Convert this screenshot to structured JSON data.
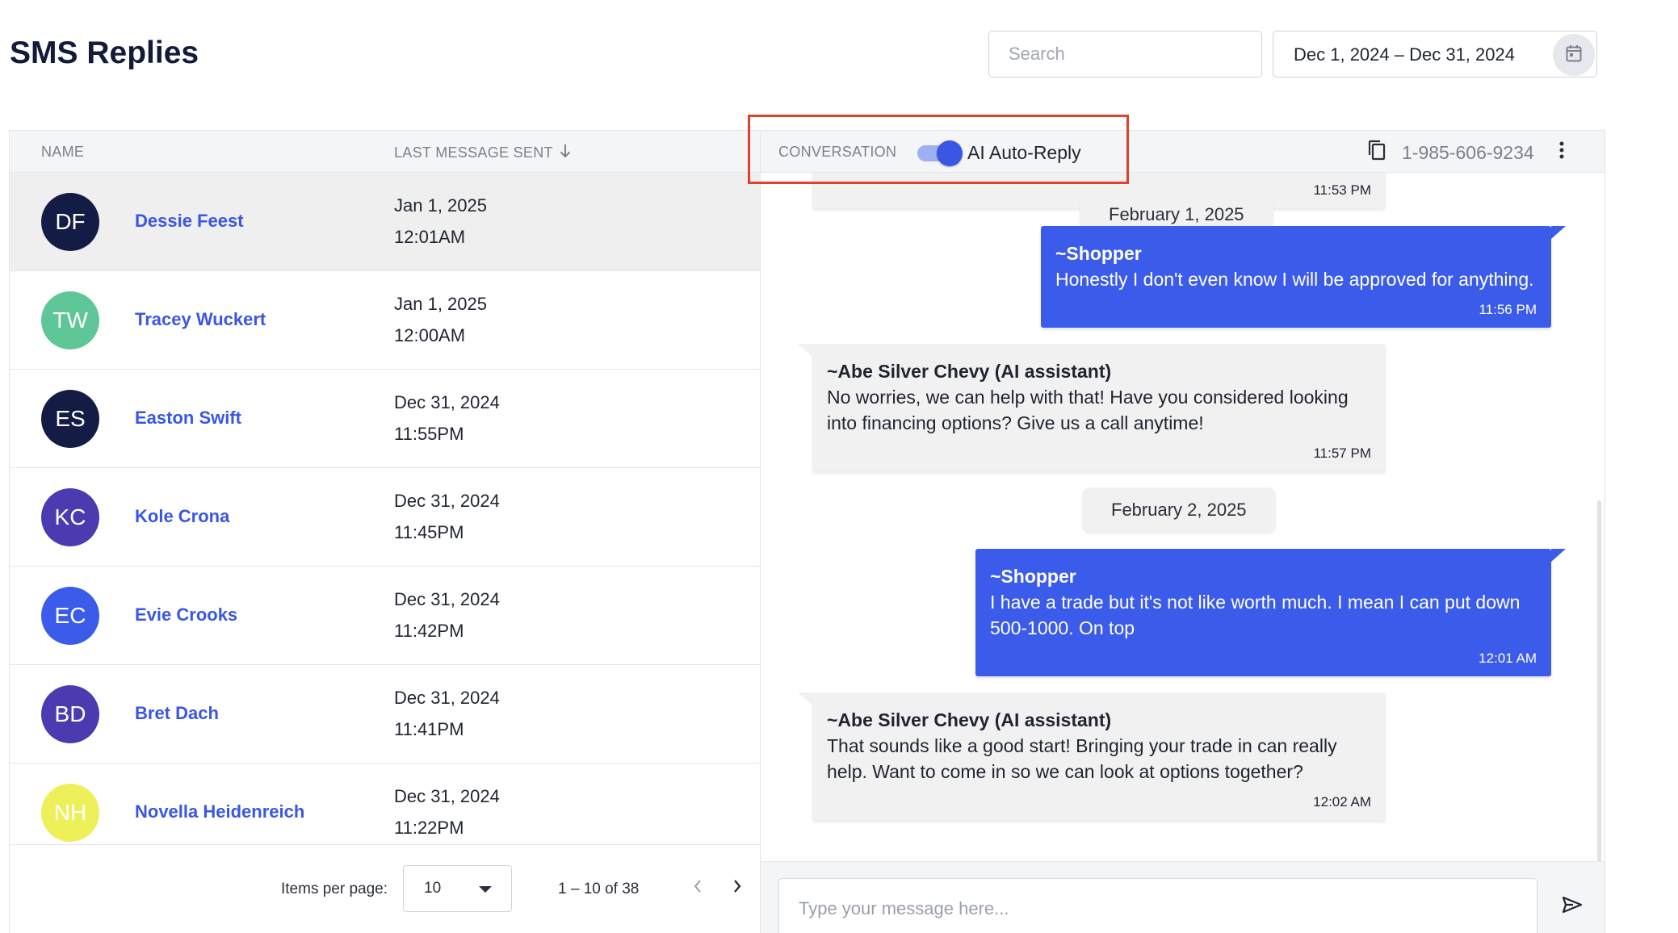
{
  "page": {
    "title": "SMS Replies"
  },
  "search": {
    "placeholder": "Search"
  },
  "date_range": {
    "value": "Dec 1, 2024 – Dec 31, 2024",
    "icon": "calendar-icon"
  },
  "list": {
    "columns": {
      "name": "NAME",
      "last_message": "LAST MESSAGE SENT"
    },
    "sort_icon": "arrow-down-icon",
    "rows": [
      {
        "initials": "DF",
        "name": "Dessie Feest",
        "date": "Jan 1, 2025",
        "time": "12:01AM",
        "avatar_color": "#141b45",
        "selected": true
      },
      {
        "initials": "TW",
        "name": "Tracey Wuckert",
        "date": "Jan 1, 2025",
        "time": "12:00AM",
        "avatar_color": "#5fc797",
        "selected": false
      },
      {
        "initials": "ES",
        "name": "Easton Swift",
        "date": "Dec 31, 2024",
        "time": "11:55PM",
        "avatar_color": "#141b45",
        "selected": false
      },
      {
        "initials": "KC",
        "name": "Kole Crona",
        "date": "Dec 31, 2024",
        "time": "11:45PM",
        "avatar_color": "#4b3bb0",
        "selected": false
      },
      {
        "initials": "EC",
        "name": "Evie Crooks",
        "date": "Dec 31, 2024",
        "time": "11:42PM",
        "avatar_color": "#3b5bea",
        "selected": false
      },
      {
        "initials": "BD",
        "name": "Bret Dach",
        "date": "Dec 31, 2024",
        "time": "11:41PM",
        "avatar_color": "#4b3bb0",
        "selected": false
      },
      {
        "initials": "NH",
        "name": "Novella Heidenreich",
        "date": "Dec 31, 2024",
        "time": "11:22PM",
        "avatar_color": "#eef05a",
        "selected": false
      }
    ]
  },
  "paginator": {
    "items_per_page_label": "Items per page:",
    "items_per_page_value": "10",
    "range_label": "1 – 10 of 38"
  },
  "conversation": {
    "label": "CONVERSATION",
    "auto_reply_label": "AI Auto-Reply",
    "auto_reply_on": true,
    "phone": "1-985-606-9234",
    "composer_placeholder": "Type your message here...",
    "top_partial_time": "11:53 PM",
    "date_dividers": [
      "February 1, 2025",
      "February 2, 2025"
    ],
    "messages": [
      {
        "direction": "out",
        "sender": "~Shopper",
        "text": "Honestly I don't even know I will be approved for anything.",
        "time": "11:56 PM"
      },
      {
        "direction": "in",
        "sender": "~Abe Silver Chevy (AI assistant)",
        "text": "No worries, we can help with that! Have you considered looking into financing options? Give us a call anytime!",
        "time": "11:57 PM"
      },
      {
        "direction": "out",
        "sender": "~Shopper",
        "text": "I have a trade but it's not like worth much. I mean I can put down 500-1000. On top",
        "time": "12:01 AM"
      },
      {
        "direction": "in",
        "sender": "~Abe Silver Chevy (AI assistant)",
        "text": "That sounds like a good start! Bringing your trade in can really help. Want to come in so we can look at options together?",
        "time": "12:02 AM"
      }
    ]
  },
  "colors": {
    "accent": "#3b5bea",
    "highlight_border": "#e0412f",
    "title": "#131a3a"
  }
}
